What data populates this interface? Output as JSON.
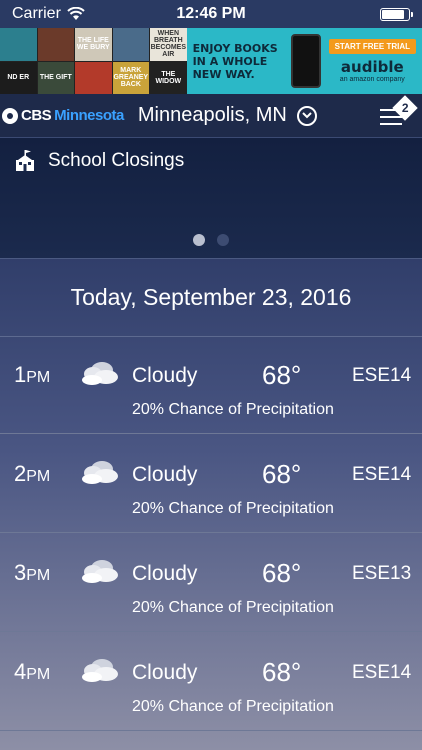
{
  "status": {
    "carrier": "Carrier",
    "time": "12:46 PM",
    "battery_level": 0.9
  },
  "ad": {
    "books": [
      "",
      "",
      "THE LIFE WE BURY",
      "",
      "WHEN BREATH BECOMES AIR",
      "ND ER",
      "THE GIFT",
      "",
      "MARK GREANEY BACK",
      "THE WIDOW"
    ],
    "slogan": "ENJOY BOOKS IN A WHOLE NEW WAY.",
    "cta": "START FREE TRIAL",
    "brand": "audible",
    "brand_sub": "an amazon company"
  },
  "header": {
    "logo_cbs": "CBS",
    "logo_city": "Minnesota",
    "location": "Minneapolis, MN",
    "menu_badge": "2"
  },
  "alert": {
    "title": "School Closings"
  },
  "forecast": {
    "date": "Today, September 23, 2016",
    "hours": [
      {
        "hour": "1",
        "ampm": "PM",
        "condition": "Cloudy",
        "temp": "68°",
        "wind": "ESE14",
        "precip": "20% Chance of Precipitation"
      },
      {
        "hour": "2",
        "ampm": "PM",
        "condition": "Cloudy",
        "temp": "68°",
        "wind": "ESE14",
        "precip": "20% Chance of Precipitation"
      },
      {
        "hour": "3",
        "ampm": "PM",
        "condition": "Cloudy",
        "temp": "68°",
        "wind": "ESE13",
        "precip": "20% Chance of Precipitation"
      },
      {
        "hour": "4",
        "ampm": "PM",
        "condition": "Cloudy",
        "temp": "68°",
        "wind": "ESE14",
        "precip": "20% Chance of Precipitation"
      }
    ]
  }
}
